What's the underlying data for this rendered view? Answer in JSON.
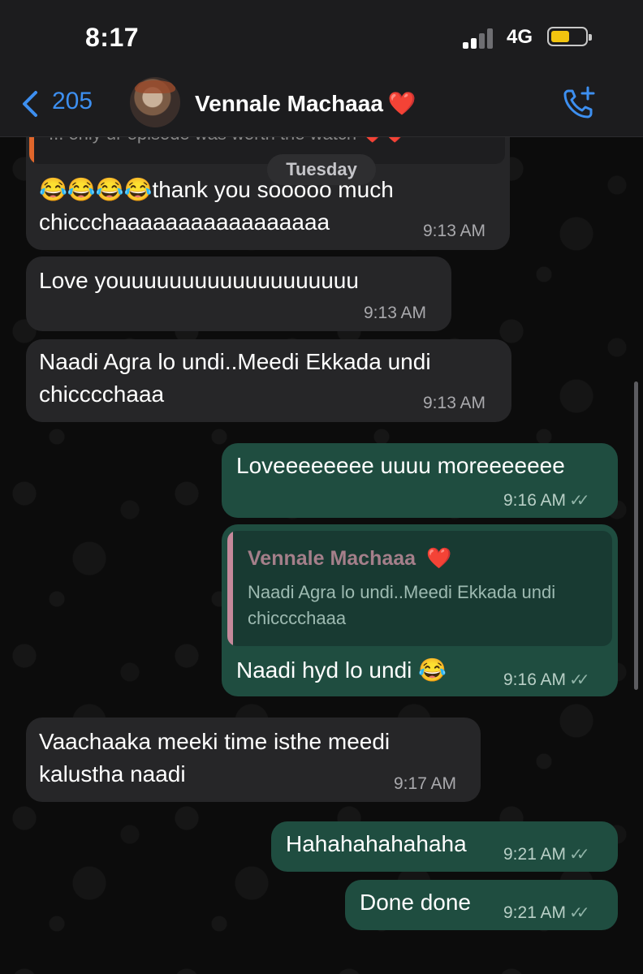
{
  "status_bar": {
    "time": "8:17",
    "network": "4G"
  },
  "header": {
    "back_count": "205",
    "contact_name": "Vennale Machaaa",
    "contact_emoji": "❤️"
  },
  "chat": {
    "partial_quote": "... only ur episode was worth the watch ❤️❤️",
    "day_label": "Tuesday",
    "messages": [
      {
        "dir": "in",
        "lines": [
          "😂😂😂😂thank you sooooo much",
          "chiccchaaaaaaaaaaaaaaaaa"
        ],
        "time": "9:13 AM"
      },
      {
        "dir": "in",
        "lines": [
          "Love youuuuuuuuuuuuuuuuuuu"
        ],
        "time": "9:13 AM"
      },
      {
        "dir": "in",
        "lines": [
          "Naadi Agra lo undi..Meedi Ekkada undi",
          "chicccchaaa"
        ],
        "time": "9:13 AM"
      },
      {
        "dir": "out",
        "lines": [
          "Loveeeeeeee uuuu moreeeeeee"
        ],
        "time": "9:16 AM"
      },
      {
        "dir": "out",
        "reply_to": {
          "name": "Vennale Machaaa",
          "emoji": "❤️",
          "text": "Naadi Agra lo undi..Meedi Ekkada undi chicccchaaa"
        },
        "lines": [
          "Naadi hyd lo undi 😂"
        ],
        "time": "9:16 AM"
      },
      {
        "dir": "in",
        "lines": [
          "Vaachaaka meeki time isthe meedi",
          "kalustha naadi"
        ],
        "time": "9:17 AM"
      },
      {
        "dir": "out",
        "lines": [
          "Hahahahahahaha"
        ],
        "time": "9:21 AM"
      },
      {
        "dir": "out",
        "lines": [
          "Done done"
        ],
        "time": "9:21 AM"
      }
    ]
  },
  "colors": {
    "incoming_bubble": "#262628",
    "outgoing_bubble": "#1f4d40",
    "accent_blue": "#3d8ff0",
    "battery": "#f1c40f"
  },
  "icons": [
    "back-chevron-icon",
    "video-call-icon",
    "signal-icon",
    "battery-icon",
    "read-ticks-icon"
  ]
}
